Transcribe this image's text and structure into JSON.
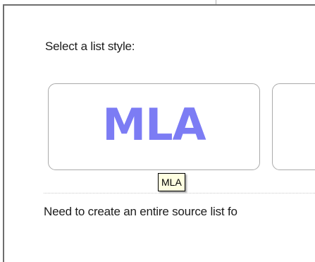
{
  "prompt": "Select a list style:",
  "styles": [
    {
      "label": "MLA",
      "color": "#7c7cf4"
    },
    {
      "label": ""
    }
  ],
  "tooltip": "MLA",
  "footer_text": "Need to create an entire source list fo"
}
